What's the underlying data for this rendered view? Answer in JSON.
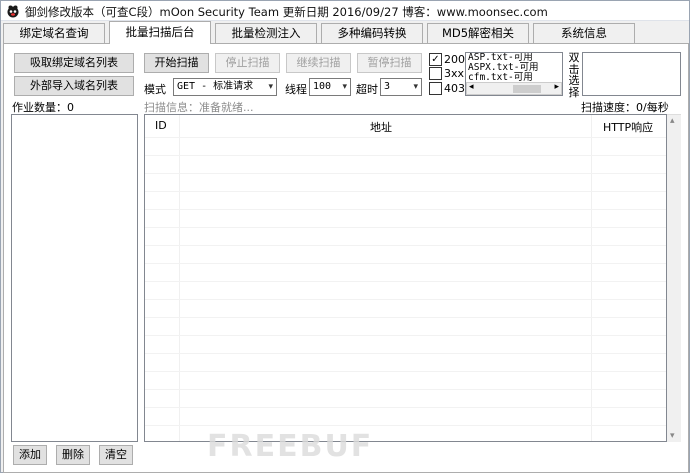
{
  "window": {
    "title": "御剑修改版本（可查C段）mOon Security Team 更新日期 2016/09/27 博客：www.moonsec.com"
  },
  "tabs": [
    {
      "label": "绑定域名查询",
      "active": false
    },
    {
      "label": "批量扫描后台",
      "active": true
    },
    {
      "label": "批量检测注入",
      "active": false
    },
    {
      "label": "多种编码转换",
      "active": false
    },
    {
      "label": "MD5解密相关",
      "active": false
    },
    {
      "label": "系统信息",
      "active": false
    }
  ],
  "left_panel": {
    "fetch_domains_button": "吸取绑定域名列表",
    "import_domains_button": "外部导入域名列表",
    "job_count_label": "作业数量：0",
    "add_button": "添加",
    "delete_button": "删除",
    "clear_button": "清空"
  },
  "toolbar": {
    "start_button": "开始扫描",
    "stop_button": "停止扫描",
    "resume_button": "继续扫描",
    "pause_button": "暂停扫描",
    "mode_label": "模式",
    "mode_value": "GET - 标准请求",
    "threads_label": "线程",
    "threads_value": "100",
    "timeout_label": "超时",
    "timeout_value": "3"
  },
  "status_filters": [
    {
      "label": "200",
      "checked": true
    },
    {
      "label": "3xx",
      "checked": false
    },
    {
      "label": "403",
      "checked": false
    }
  ],
  "dictionaries": [
    "ASP.txt-可用",
    "ASPX.txt-可用",
    "cfm.txt-可用"
  ],
  "dbl_click_hint": "双击选择",
  "scan_info_label": "扫描信息：准备就绪...",
  "scan_speed_label": "扫描速度：0/每秒",
  "results_table": {
    "columns": [
      "ID",
      "地址",
      "HTTP响应"
    ],
    "rows": []
  },
  "watermark": "FREEBUF"
}
